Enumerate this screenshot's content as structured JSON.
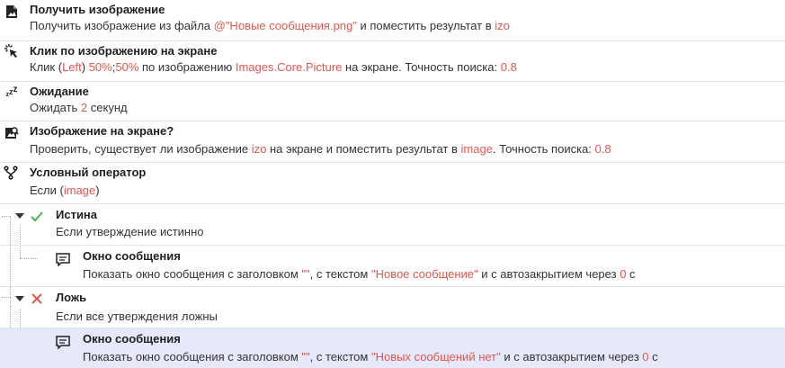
{
  "steps": [
    {
      "icon": "image-file-icon",
      "title": "Получить изображение",
      "desc": [
        "Получить изображение из файла ",
        "@\"Новые сообщения.png\"",
        " и поместить результат в ",
        "izo",
        ""
      ]
    },
    {
      "icon": "click-pointer-icon",
      "title": "Клик по изображению на экране",
      "desc": [
        "Клик (",
        "Left",
        ") ",
        "50%",
        ";",
        "50%",
        " по изображению ",
        "Images.Core.Picture",
        " на экране. Точность поиска: ",
        "0.8",
        ""
      ]
    },
    {
      "icon": "sleep-zzz-icon",
      "title": "Ожидание",
      "desc": [
        "Ожидать ",
        "2",
        " секунд"
      ]
    },
    {
      "icon": "image-search-icon",
      "title": "Изображение на экране?",
      "desc": [
        "Проверить, существует ли изображение ",
        "izo",
        " на экране и поместить результат в ",
        "image",
        ". Точность поиска: ",
        "0.8",
        ""
      ]
    },
    {
      "icon": "branch-icon",
      "title": "Условный оператор",
      "desc": [
        "Если (",
        "image",
        ")"
      ]
    },
    {
      "icon": "checkmark-icon",
      "title": "Истина",
      "desc": [
        "Если утверждение истинно"
      ]
    },
    {
      "icon": "message-box-icon",
      "title": "Окно сообщения",
      "desc": [
        "Показать окно сообщения с заголовком ",
        "\"\"",
        ", с текстом ",
        "\"Новое сообщение\"",
        " и с автозакрытием через ",
        "0",
        " с"
      ]
    },
    {
      "icon": "cross-icon",
      "title": "Ложь",
      "desc": [
        "Если все утверждения ложны"
      ]
    },
    {
      "icon": "message-box-icon",
      "title": "Окно сообщения",
      "desc": [
        "Показать окно сообщения с заголовком ",
        "\"\"",
        ", с текстом ",
        "\"Новых сообщений нет\"",
        " и с автозакрытием через ",
        "0",
        " с"
      ]
    }
  ],
  "colors": {
    "highlight": "#e0574f",
    "selected_row": "#e6e8fb",
    "check": "#4caf50",
    "cross": "#e0574f"
  }
}
